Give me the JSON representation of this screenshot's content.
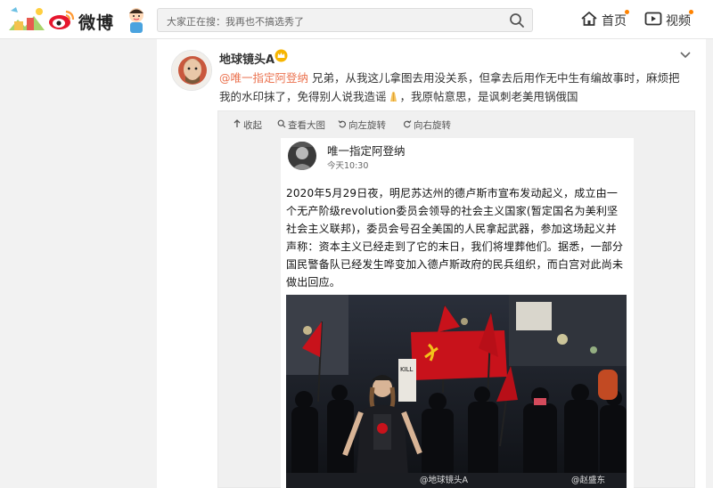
{
  "topbar": {
    "logo_text": "微博",
    "search_placeholder": "大家正在搜：我再也不搞选秀了",
    "nav": [
      {
        "label": "首页",
        "icon": "home-icon"
      },
      {
        "label": "视频",
        "icon": "video-icon"
      }
    ]
  },
  "post": {
    "username": "地球镜头A",
    "badge_icon": "vip-crown-icon",
    "menu_icon": "chevron-down-icon",
    "mention": "@唯一指定阿登纳",
    "text_part1": " 兄弟，从我这儿拿图去用没关系，但拿去后用作无中生有编故事时，麻烦把我的水印抹了，免得别人说我造谣",
    "emoji_icon": "folded-hands-icon",
    "text_part2": "，我原帖意思，是讽刺老美甩锅俄国"
  },
  "media_toolbar": [
    {
      "label": "收起",
      "icon": "collapse-arrow-icon"
    },
    {
      "label": "查看大图",
      "icon": "magnifier-icon"
    },
    {
      "label": "向左旋转",
      "icon": "rotate-left-icon"
    },
    {
      "label": "向右旋转",
      "icon": "rotate-right-icon"
    }
  ],
  "repost_screenshot": {
    "author": "唯一指定阿登纳",
    "time": "今天10:30",
    "body": "2020年5月29日夜，明尼苏达州的德卢斯市宣布发动起义，成立由一个无产阶级revolution委员会领导的社会主义国家(暂定国名为美利坚社会主义联邦)，委员会号召全美国的人民拿起武器，参加这场起义并声称：资本主义已经走到了它的末日，我们将埋葬他们。据悉，一部分国民警备队已经发生哗变加入德卢斯政府的民兵组织，而白宫对此尚未做出回应。",
    "photo": {
      "sign_text": "KILL YOUR SHOP",
      "watermark_1": "@地球镜头A",
      "watermark_2": "@赵盛东"
    }
  },
  "colors": {
    "accent_orange": "#ff8200",
    "mention": "#eb7350",
    "flag_red": "#c8121b"
  }
}
